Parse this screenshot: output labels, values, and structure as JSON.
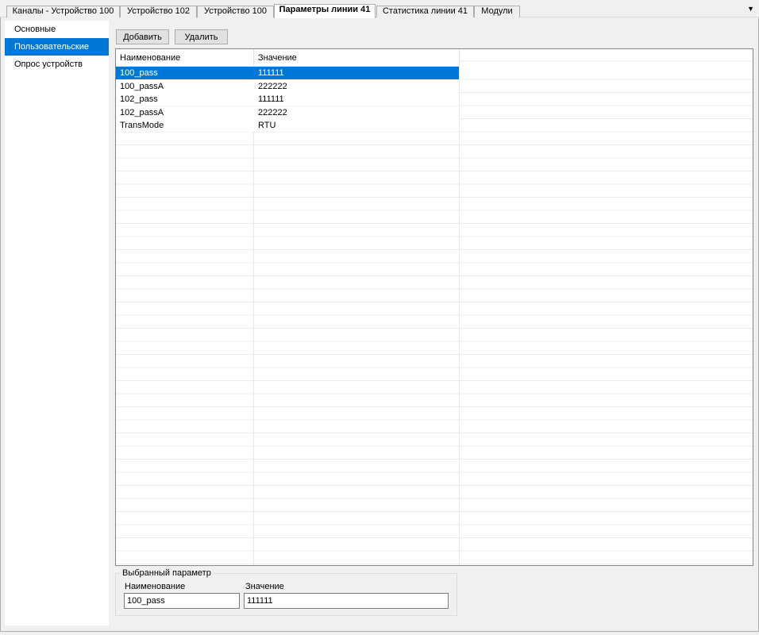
{
  "tabs": [
    {
      "label": "Каналы - Устройство 100"
    },
    {
      "label": "Устройство 102"
    },
    {
      "label": "Устройство 100"
    },
    {
      "label": "Параметры линии 41",
      "active": true
    },
    {
      "label": "Статистика линии 41"
    },
    {
      "label": "Модули"
    }
  ],
  "tab_menu_icon": "dropdown-arrow-icon",
  "sidebar": {
    "items": [
      {
        "label": "Основные"
      },
      {
        "label": "Пользовательские",
        "selected": true
      },
      {
        "label": "Опрос устройств"
      }
    ]
  },
  "toolbar": {
    "add_label": "Добавить",
    "delete_label": "Удалить"
  },
  "grid": {
    "columns": [
      "Наименование",
      "Значение"
    ],
    "rows": [
      {
        "name": "100_pass",
        "value": "111111",
        "selected": true
      },
      {
        "name": "100_passA",
        "value": "222222"
      },
      {
        "name": "102_pass",
        "value": "111111"
      },
      {
        "name": "102_passA",
        "value": "222222"
      },
      {
        "name": "TransMode",
        "value": "RTU"
      }
    ]
  },
  "selected_param": {
    "legend": "Выбранный параметр",
    "name_label": "Наименование",
    "value_label": "Значение",
    "name_value": "100_pass",
    "value_value": "111111"
  },
  "colors": {
    "accent": "#0078d7",
    "background": "#f0f0f0"
  }
}
